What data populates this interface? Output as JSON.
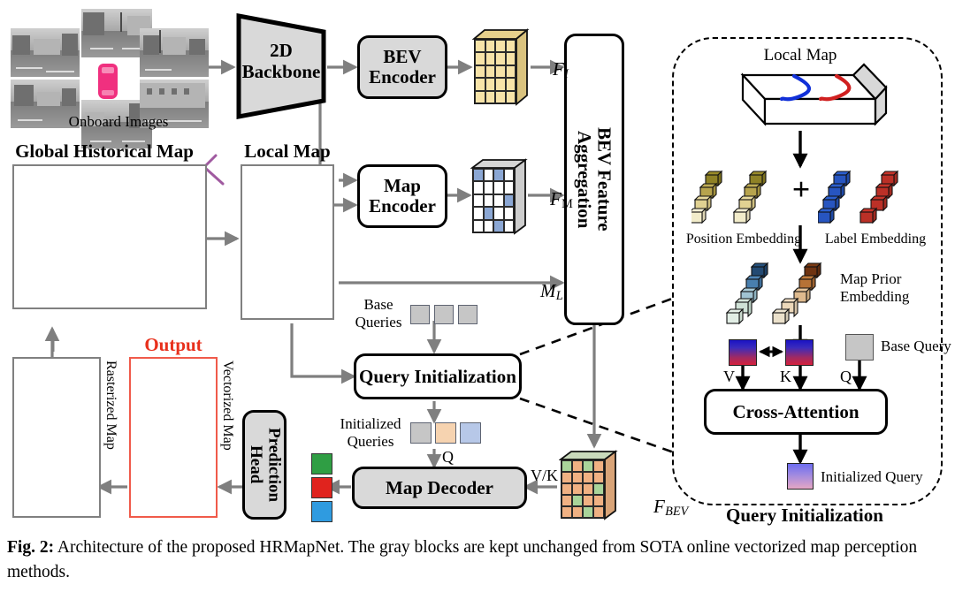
{
  "figure": {
    "caption_label": "Fig. 2:",
    "caption_text": " Architecture of the proposed HRMapNet. The gray blocks are kept unchanged from SOTA online vectorized map perception methods."
  },
  "inputs": {
    "onboard_images_label": "Onboard Images",
    "global_map_label": "Global Historical Map",
    "local_map_label": "Local Map"
  },
  "blocks": {
    "backbone": "2D\nBackbone",
    "bev_encoder": "BEV\nEncoder",
    "map_encoder": "Map\nEncoder",
    "bev_aggregation": "BEV Feature\nAggregation",
    "query_init": "Query Initialization",
    "map_decoder": "Map Decoder",
    "prediction_head": "Prediction\nHead",
    "cross_attention": "Cross-Attention"
  },
  "tensors": {
    "f_image": "F",
    "f_image_sub": "I",
    "f_map": "F",
    "f_map_sub": "M",
    "m_local": "M",
    "m_local_sub": "L",
    "f_bev": "F",
    "f_bev_sub": "BEV"
  },
  "queries": {
    "base_queries_label": "Base\nQueries",
    "initialized_queries_label": "Initialized\nQueries",
    "q_label": "Q",
    "vk_label": "V/K"
  },
  "output": {
    "title": "Output",
    "rasterized_label": "Rasterized Map",
    "vectorized_label": "Vectorized Map"
  },
  "detail_panel": {
    "title": "Query Initialization",
    "local_map_label": "Local Map",
    "position_embedding_label": "Position Embedding",
    "label_embedding_label": "Label Embedding",
    "map_prior_label": "Map Prior\nEmbedding",
    "plus_symbol": "+",
    "base_query_label": "Base Query",
    "initialized_query_label": "Initialized Query",
    "v_label": "V",
    "k_label": "K",
    "q_label": "Q"
  },
  "colors": {
    "gray_block": "#d9d9d9",
    "arrow_gray": "#7f7f7f",
    "arrow_black": "#000000",
    "output_red": "#e8301c",
    "f_image_cell": "#f7e3a8",
    "f_map_cell_on": "#8ba7d4",
    "f_map_cell_off": "#ffffff",
    "f_bev_cell_a": "#f0b183",
    "f_bev_cell_b": "#a9d49a",
    "class_green": "#2f9e44",
    "class_red": "#e0231e",
    "class_blue": "#2f9be0",
    "ego_car": "#f0307f",
    "map_divider_blue": "#1a3fd4",
    "map_boundary_red": "#d43a3a",
    "map_ped_green": "#5fd45f",
    "base_query_fill": "#c6c6c6",
    "init_query_peach": "#f6d3b0",
    "init_query_blue": "#b7c8e8"
  },
  "feature_maps": {
    "f_image_grid": {
      "cols": 4,
      "rows": 5,
      "cells": [
        [
          1,
          1,
          1,
          1
        ],
        [
          1,
          1,
          1,
          1
        ],
        [
          1,
          1,
          1,
          1
        ],
        [
          1,
          1,
          1,
          1
        ],
        [
          1,
          1,
          1,
          1
        ]
      ]
    },
    "f_map_grid": {
      "cols": 4,
      "rows": 5,
      "cells": [
        [
          1,
          0,
          1,
          0
        ],
        [
          0,
          0,
          0,
          0
        ],
        [
          0,
          0,
          0,
          1
        ],
        [
          0,
          1,
          0,
          0
        ],
        [
          0,
          0,
          1,
          0
        ]
      ]
    },
    "f_bev_grid": {
      "cols": 4,
      "rows": 5,
      "cells": [
        [
          1,
          0,
          1,
          0
        ],
        [
          0,
          0,
          0,
          0
        ],
        [
          0,
          0,
          0,
          1
        ],
        [
          0,
          1,
          0,
          0
        ],
        [
          0,
          0,
          1,
          0
        ]
      ]
    }
  }
}
